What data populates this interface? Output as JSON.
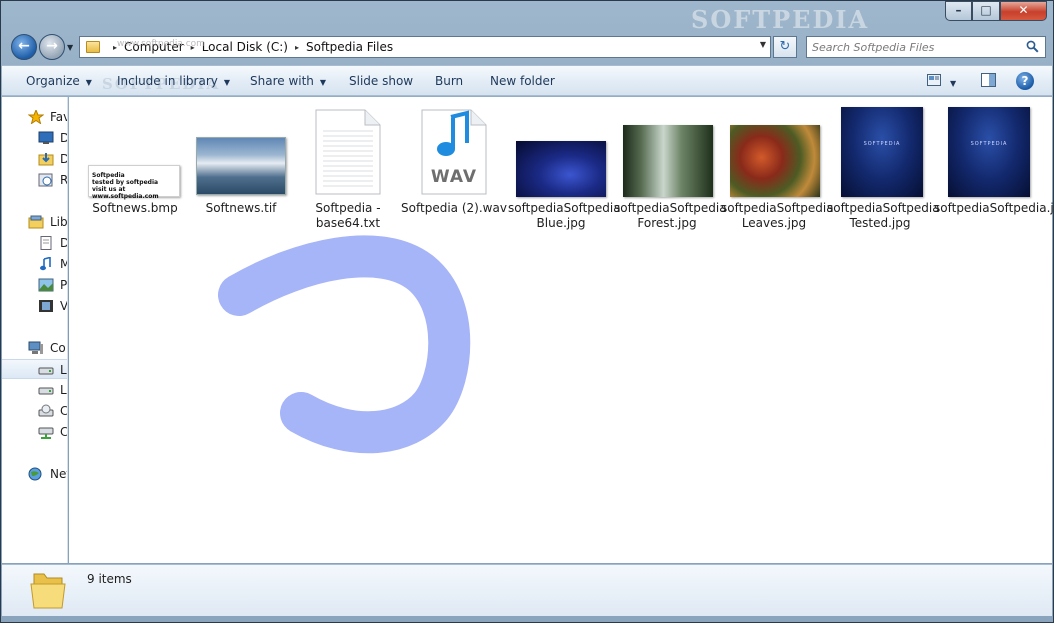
{
  "window": {
    "watermark": "SOFTPEDIA",
    "controls": {
      "minimize": "–",
      "maximize": "□",
      "close": "✕"
    }
  },
  "nav": {
    "back": "←",
    "forward": "→",
    "dropdown": "▼"
  },
  "address": {
    "crumbs": [
      "Computer",
      "Local Disk (C:)",
      "Softpedia Files"
    ],
    "separator": "▸",
    "dropdown": "▼",
    "refresh": "↻"
  },
  "search": {
    "placeholder": "Search Softpedia Files"
  },
  "commandbar": {
    "watermark": "SOFTPEDIA",
    "watermark_url": "www.softpedia.com",
    "organize": "Organize",
    "include_in_library": "Include in library",
    "share_with": "Share with",
    "slide_show": "Slide show",
    "burn": "Burn",
    "new_folder": "New folder",
    "arrow": "▼",
    "help": "?"
  },
  "navpane": {
    "items": [
      {
        "label": "Fav",
        "icon": "star-icon",
        "indent": "top"
      },
      {
        "label": "D",
        "icon": "desktop-icon",
        "indent": "child"
      },
      {
        "label": "D",
        "icon": "downloads-icon",
        "indent": "child"
      },
      {
        "label": "R",
        "icon": "recent-places-icon",
        "indent": "child"
      },
      {
        "label": "Libr",
        "icon": "libraries-icon",
        "indent": "top"
      },
      {
        "label": "D",
        "icon": "documents-icon",
        "indent": "child"
      },
      {
        "label": "M",
        "icon": "music-icon",
        "indent": "child"
      },
      {
        "label": "P",
        "icon": "pictures-icon",
        "indent": "child"
      },
      {
        "label": "V",
        "icon": "videos-icon",
        "indent": "child"
      },
      {
        "label": "Co",
        "icon": "computer-icon",
        "indent": "top"
      },
      {
        "label": "L",
        "icon": "local-disk-icon",
        "indent": "child",
        "selected": true
      },
      {
        "label": "L",
        "icon": "local-disk-icon",
        "indent": "child"
      },
      {
        "label": "C",
        "icon": "cd-drive-icon",
        "indent": "child"
      },
      {
        "label": "C",
        "icon": "network-drive-icon",
        "indent": "child"
      },
      {
        "label": "Net",
        "icon": "network-icon",
        "indent": "top"
      }
    ]
  },
  "files": [
    {
      "name": "Softnews.bmp",
      "thumb": "bmp-thumbnail",
      "bmp_lines": [
        "Softpedia",
        "tested by softpedia",
        "visit us at www.softpedia.com"
      ]
    },
    {
      "name": "Softnews.tif",
      "thumb": "tif-thumbnail"
    },
    {
      "name": "Softpedia - base64.txt",
      "thumb": "text-document-icon"
    },
    {
      "name": "Softpedia (2).wav",
      "thumb": "wav-audio-icon",
      "badge": "WAV"
    },
    {
      "name": "softpediaSoftpedia Blue.jpg",
      "thumb": "blue-jpg-thumbnail"
    },
    {
      "name": "softpediaSoftpedia Forest.jpg",
      "thumb": "forest-jpg-thumbnail"
    },
    {
      "name": "softpediaSoftpedia Leaves.jpg",
      "thumb": "leaves-jpg-thumbnail"
    },
    {
      "name": "softpediaSoftpedia Tested.jpg",
      "thumb": "tested-jpg-thumbnail",
      "caption": "SOFTPEDIA"
    },
    {
      "name": "softpediaSoftpedia.jpg",
      "thumb": "softpedia-jpg-thumbnail",
      "caption": "SOFTPEDIA"
    }
  ],
  "status": {
    "count": "9 items"
  },
  "colors": {
    "accent": "#1e395b",
    "brush": "#a6b4f8",
    "selection": "#dce8f5"
  }
}
